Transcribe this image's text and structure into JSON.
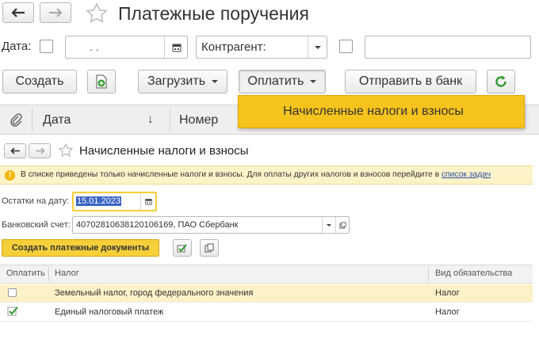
{
  "top": {
    "title": "Платежные поручения",
    "filter": {
      "date_label": "Дата:",
      "date_value": ". .",
      "contractor_label": "Контрагент:"
    },
    "toolbar": {
      "create": "Создать",
      "load": "Загрузить",
      "pay": "Оплатить",
      "send": "Отправить в банк"
    },
    "columns": {
      "date": "Дата",
      "number": "Номер"
    },
    "pay_menu": {
      "item": "Начисленные налоги и взносы"
    }
  },
  "sub": {
    "title": "Начисленные налоги и взносы",
    "info": {
      "text": "В списке приведены только начисленные налоги и взносы. Для оплаты других налогов и взносов перейдите в",
      "link": "список задач"
    },
    "balance": {
      "label": "Остатки на дату:",
      "value": "15.01.2023"
    },
    "account": {
      "label": "Банковский счет:",
      "value": "40702810638120106169, ПАО Сбербанк"
    },
    "create_docs": "Создать платежные документы",
    "table": {
      "headers": {
        "pay": "Оплатить",
        "tax": "Налог",
        "type": "Вид обязательства"
      },
      "rows": [
        {
          "checked": false,
          "tax": "Земельный налог, город федерального значения",
          "type": "Налог"
        },
        {
          "checked": true,
          "tax": "Единый налоговый платеж",
          "type": "Налог"
        }
      ]
    }
  },
  "colors": {
    "accent_yellow": "#f6cf3a",
    "menu_yellow": "#f7c31d",
    "row_highlight": "#fdf1c7",
    "link": "#2a4fa8",
    "green": "#3a9a3a"
  }
}
